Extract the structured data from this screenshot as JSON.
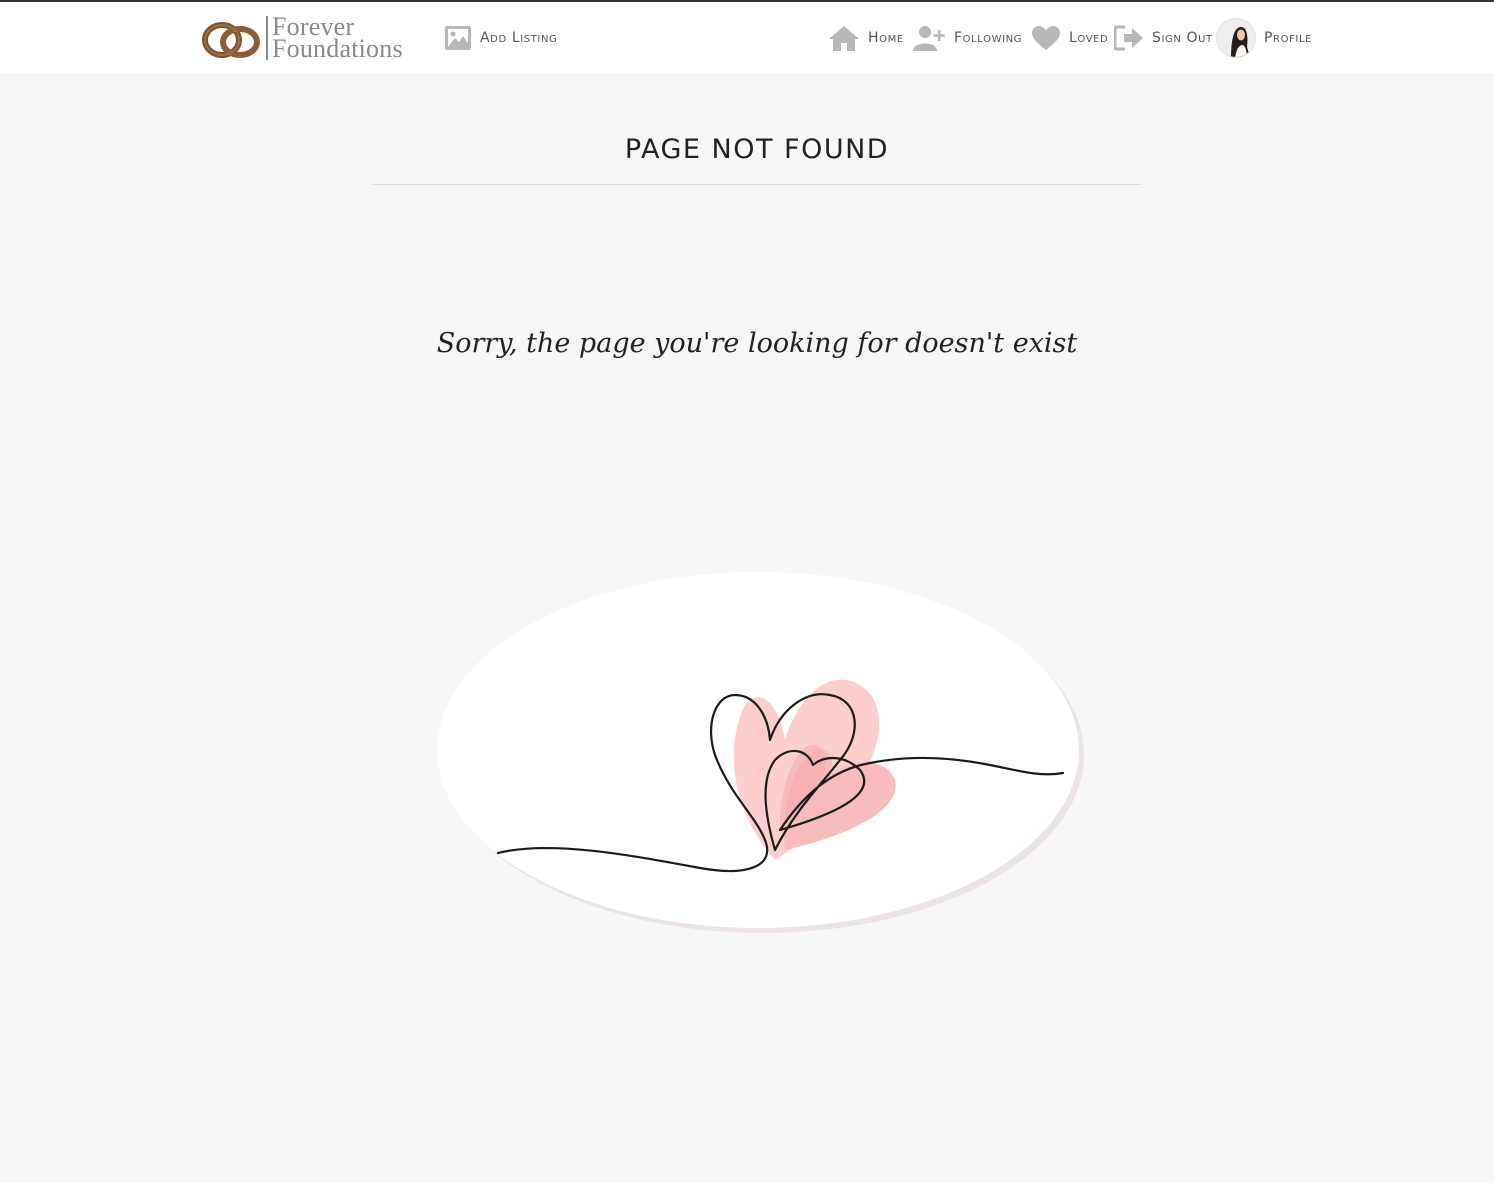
{
  "brand": {
    "name_line1": "Forever",
    "name_line2": "Foundations",
    "color": "#8a8a8a",
    "logo_color": "#7a5230"
  },
  "nav": {
    "add_listing": {
      "label": "Add Listing",
      "icon": "image-icon"
    },
    "home": {
      "label": "Home",
      "icon": "home-icon"
    },
    "following": {
      "label": "Following",
      "icon": "user-plus-icon"
    },
    "loved": {
      "label": "Loved",
      "icon": "heart-icon"
    },
    "sign_out": {
      "label": "Sign Out",
      "icon": "sign-out-icon"
    },
    "profile": {
      "label": "Profile",
      "icon": "avatar"
    }
  },
  "main": {
    "title": "PAGE NOT FOUND",
    "message": "Sorry, the page you're looking for doesn't exist"
  },
  "colors": {
    "background": "#f7f7f7",
    "icon_gray": "#b7b7b7",
    "heart_pink": "#fbbcbc"
  }
}
